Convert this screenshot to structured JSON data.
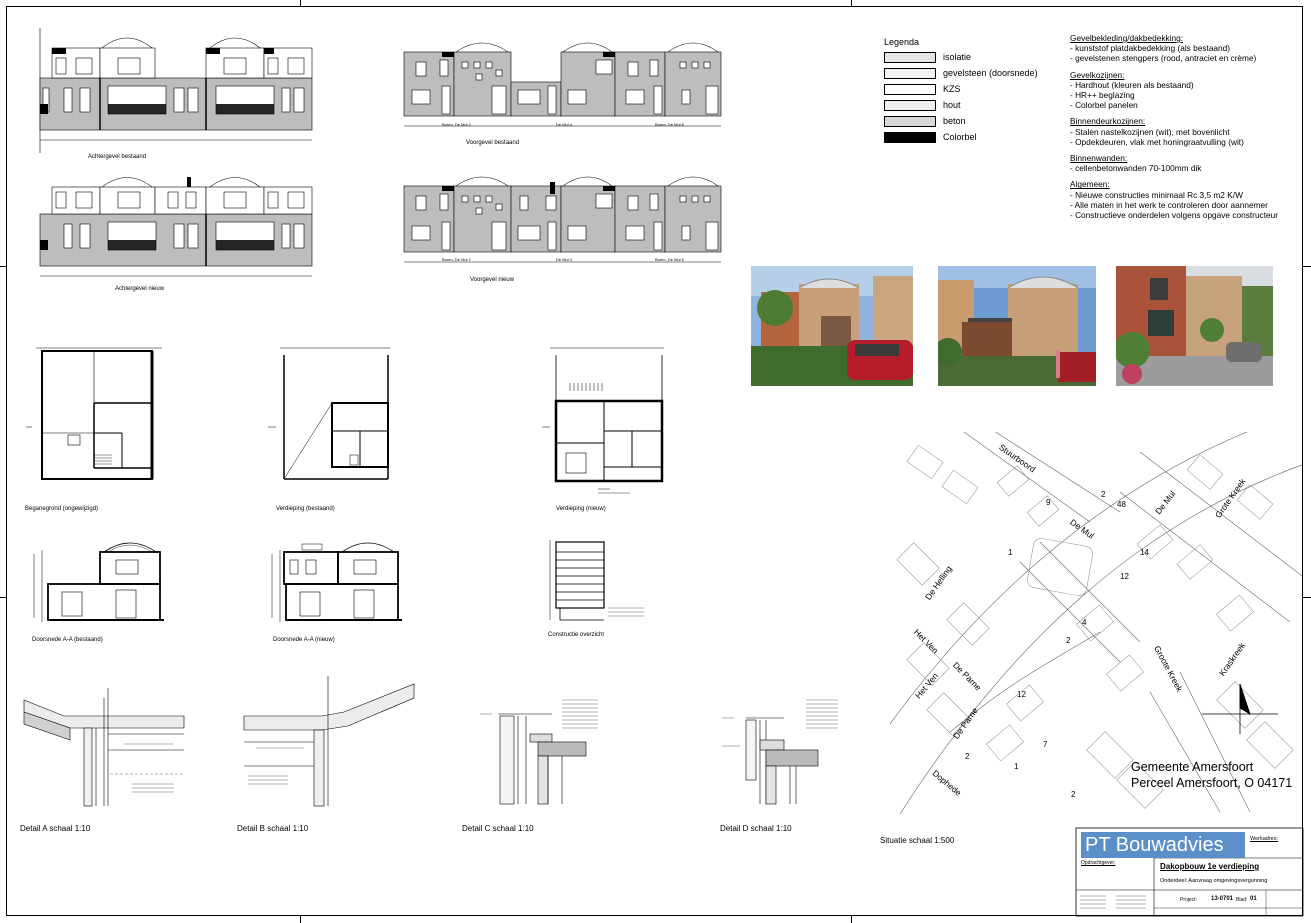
{
  "drawings": {
    "achtergevel_bestaand": "Achtergevel bestaand",
    "achtergevel_nieuw": "Achtergevel nieuw",
    "voorgevel_bestaand": "Voorgevel bestaand",
    "voorgevel_nieuw": "Voorgevel nieuw",
    "begane_grond": "Beganegrond (ongewijzigd)",
    "verdieping_bestaand": "Verdieping (bestaand)",
    "verdieping_nieuw": "Verdieping (nieuw)",
    "doorsnede_bestaand": "Doorsnede A-A (bestaand)",
    "doorsnede_nieuw": "Doorsnede A-A (nieuw)",
    "constructie": "Constructie overzicht",
    "detail_a": "Detail A schaal 1:10",
    "detail_b": "Detail B schaal 1:10",
    "detail_c": "Detail C schaal 1:10",
    "detail_d": "Detail D schaal 1:10",
    "situatie": "Situatie schaal 1:500"
  },
  "facade_labels": {
    "buren_2": "Buren, De Mul 2",
    "de_mul_4": "De Mul 4",
    "buren_6": "Buren, De Mul 6"
  },
  "legend": {
    "title": "Legenda",
    "items": [
      {
        "label": "isolatie",
        "fill": "#e6e6e6"
      },
      {
        "label": "gevelsteen (doorsnede)",
        "fill": "#f2f2f2"
      },
      {
        "label": "KZS",
        "fill": "#ffffff"
      },
      {
        "label": "hout",
        "fill": "#efefef"
      },
      {
        "label": "beton",
        "fill": "#d8d8d8"
      },
      {
        "label": "Colorbel",
        "fill": "#000000"
      }
    ]
  },
  "notes": [
    {
      "heading": "Gevelbekleding/dakbedekking:",
      "lines": [
        "- kunststof platdakbedekking (als bestaand)",
        "- gevelstenen stengpers (rood, antraciet en crème)"
      ]
    },
    {
      "heading": "Gevelkozijnen:",
      "lines": [
        "- Hardhout (kleuren als bestaand)",
        "- HR++ beglazing",
        "- Colorbel panelen"
      ]
    },
    {
      "heading": "Binnendeurkozijnen:",
      "lines": [
        "- Stalen nastelkozijnen (wit), met bovenlicht",
        "- Opdekdeuren, vlak met honingraatvulling (wit)"
      ]
    },
    {
      "heading": "Binnenwanden:",
      "lines": [
        "- cellenbetonwanden 70-100mm dik"
      ]
    },
    {
      "heading": "Algemeen:",
      "lines": [
        "- Nieuwe constructies minimaal Rc 3,5 m2 K/W",
        "- Alle maten in het werk te controleren door aannemer",
        "- Constructieve onderdelen volgens opgave constructeur"
      ]
    }
  ],
  "map": {
    "streets": [
      "Stuurboord",
      "De Mul",
      "De Mul",
      "Grote Kreek",
      "De Helling",
      "Het Ven",
      "Het Ven",
      "De Parne",
      "De Parne",
      "Groote Kreek",
      "Kraskreek",
      "Dophede"
    ],
    "numbers": [
      "9",
      "2",
      "48",
      "1",
      "14",
      "12",
      "2",
      "4",
      "12",
      "2",
      "1",
      "7",
      "2"
    ],
    "municipality": "Gemeente Amersfoort",
    "parcel": "Perceel Amersfoort, O 04171"
  },
  "title_block": {
    "brand": "PT Bouwadvies",
    "project_label": "Werkadres:",
    "client_label": "Opdrachtgever:",
    "title": "Dakopbouw 1e verdieping",
    "subtitle": "Onderdeel: Aanvraag omgevingsvergunning",
    "project_no_label": "Project:",
    "project_no": "13-0701",
    "sheet_label": "Blad:",
    "sheet_no": "01"
  }
}
